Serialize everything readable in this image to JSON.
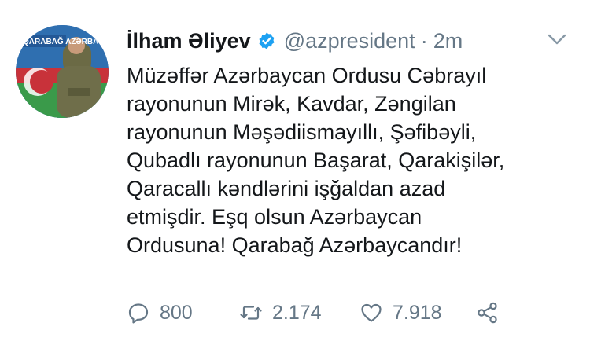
{
  "tweet": {
    "display_name": "İlham Əliyev",
    "handle": "@azpresident",
    "separator": "·",
    "time": "2m",
    "avatar_text": "QARABAĞ AZƏRBAYCANDIR!",
    "lines": [
      "Müzəffər Azərbaycan Ordusu Cəbrayıl",
      "rayonunun Mirək, Kavdar, Zəngilan",
      "rayonunun Məşədiismayıllı, Şəfibəyli,",
      "Qubadlı rayonunun Başarat, Qarakişilər,",
      "Qaracallı kəndlərini işğaldan azad",
      "etmişdir. Eşq olsun Azərbaycan",
      "Ordusuna! Qarabağ Azərbaycandır!"
    ],
    "actions": {
      "replies": "800",
      "retweets": "2.174",
      "likes": "7.918"
    },
    "icons": {
      "reply": "reply-icon",
      "retweet": "retweet-icon",
      "like": "heart-icon",
      "share": "share-icon",
      "verified": "verified-badge-icon",
      "menu": "chevron-down-icon"
    },
    "colors": {
      "text": "#14171a",
      "muted": "#657786",
      "verified": "#1da1f2"
    }
  }
}
